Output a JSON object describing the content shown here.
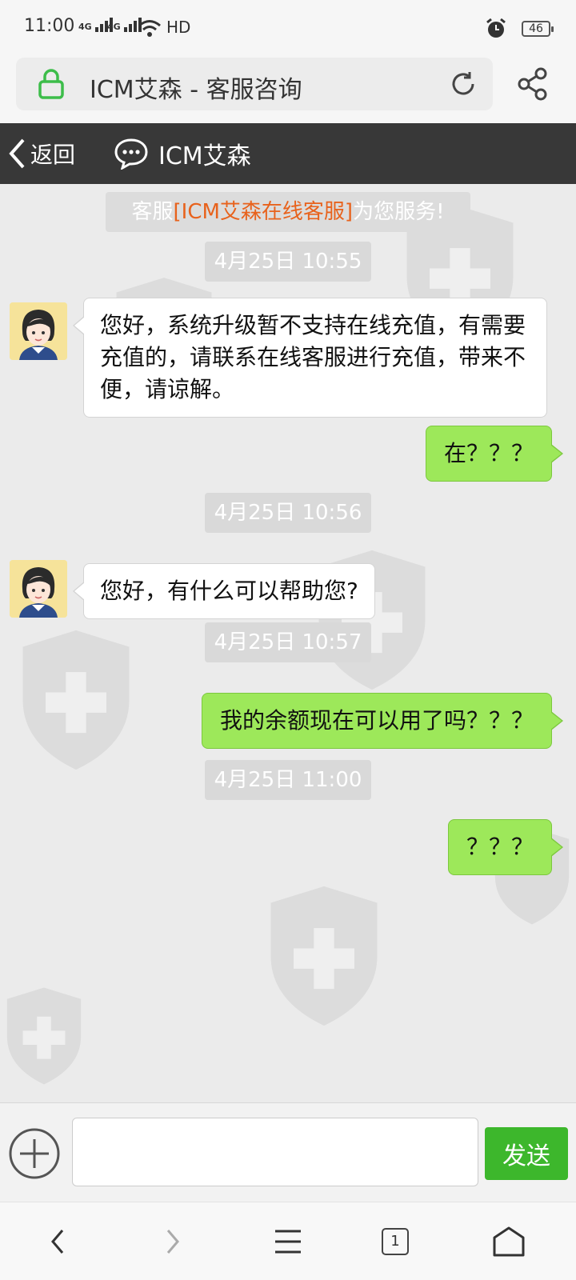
{
  "status_bar": {
    "time": "11:00",
    "signal_1": "4G",
    "signal_2": "4G",
    "network_label": "HD",
    "battery_level": "46",
    "icons": [
      "signal-icon",
      "wifi-icon",
      "alarm-icon",
      "battery-icon"
    ]
  },
  "address_bar": {
    "page_title": "ICM艾森 - 客服咨询",
    "lock_color": "#3dbd4a"
  },
  "chat_header": {
    "back_label": "返回",
    "title": "ICM艾森"
  },
  "chat": {
    "notice_prefix": "客服",
    "notice_highlight": "[ICM艾森在线客服]",
    "notice_suffix": "为您服务!",
    "messages": [
      {
        "type": "time",
        "text": "4月25日 10:55"
      },
      {
        "type": "in",
        "text": "您好，系统升级暂不支持在线充值，有需要充值的，请联系在线客服进行充值，带来不便，请谅解。"
      },
      {
        "type": "out",
        "text": "在？？？"
      },
      {
        "type": "time",
        "text": "4月25日 10:56"
      },
      {
        "type": "in",
        "text": "您好，有什么可以帮助您?"
      },
      {
        "type": "time",
        "text": "4月25日 10:57"
      },
      {
        "type": "out",
        "text": "我的余额现在可以用了吗？？？"
      },
      {
        "type": "time",
        "text": "4月25日 11:00"
      },
      {
        "type": "out",
        "text": "？？？"
      }
    ]
  },
  "input_bar": {
    "message_value": "",
    "send_label": "发送",
    "send_color": "#3db72c"
  },
  "bottom_nav": {
    "tab_count": "1",
    "icons": [
      "back-arrow-icon",
      "forward-arrow-icon",
      "menu-icon",
      "tabs-icon",
      "home-icon"
    ]
  },
  "colors": {
    "header_bg": "#383838",
    "bubble_out": "#9de85a",
    "highlight": "#e8621c"
  }
}
